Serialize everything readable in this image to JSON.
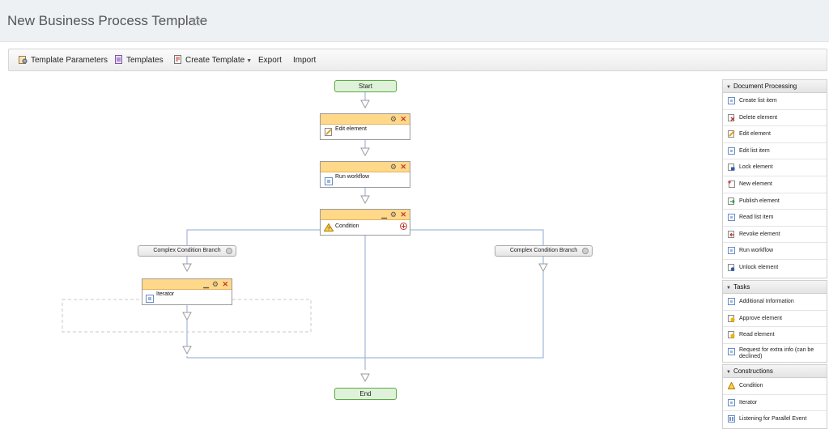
{
  "header": {
    "title": "New Business Process Template"
  },
  "toolbar": {
    "template_parameters": "Template Parameters",
    "templates": "Templates",
    "create_template": "Create Template",
    "export": "Export",
    "import": "Import"
  },
  "flow": {
    "start": "Start",
    "end": "End",
    "edit_element": "Edit element",
    "run_workflow": "Run workflow",
    "condition": "Condition",
    "branch_left": "Complex Condition Branch",
    "branch_right": "Complex Condition Branch",
    "iterator": "Iterator"
  },
  "panels": {
    "document_processing": {
      "title": "Document Processing",
      "items": [
        "Create list item",
        "Delete element",
        "Edit element",
        "Edit list item",
        "Lock element",
        "New element",
        "Publish element",
        "Read list item",
        "Revoke element",
        "Run workflow",
        "Unlock element"
      ]
    },
    "tasks": {
      "title": "Tasks",
      "items": [
        "Additional Information",
        "Approve element",
        "Read element",
        "Request for extra info (can be declined)"
      ]
    },
    "constructions": {
      "title": "Constructions",
      "items": [
        "Condition",
        "Iterator",
        "Listening for Parallel Event"
      ]
    }
  },
  "colors": {
    "node_header": "#ffd88a",
    "start_end_fill": "#dff2d9",
    "start_end_border": "#5ca845",
    "connector": "#8fa8d0"
  }
}
